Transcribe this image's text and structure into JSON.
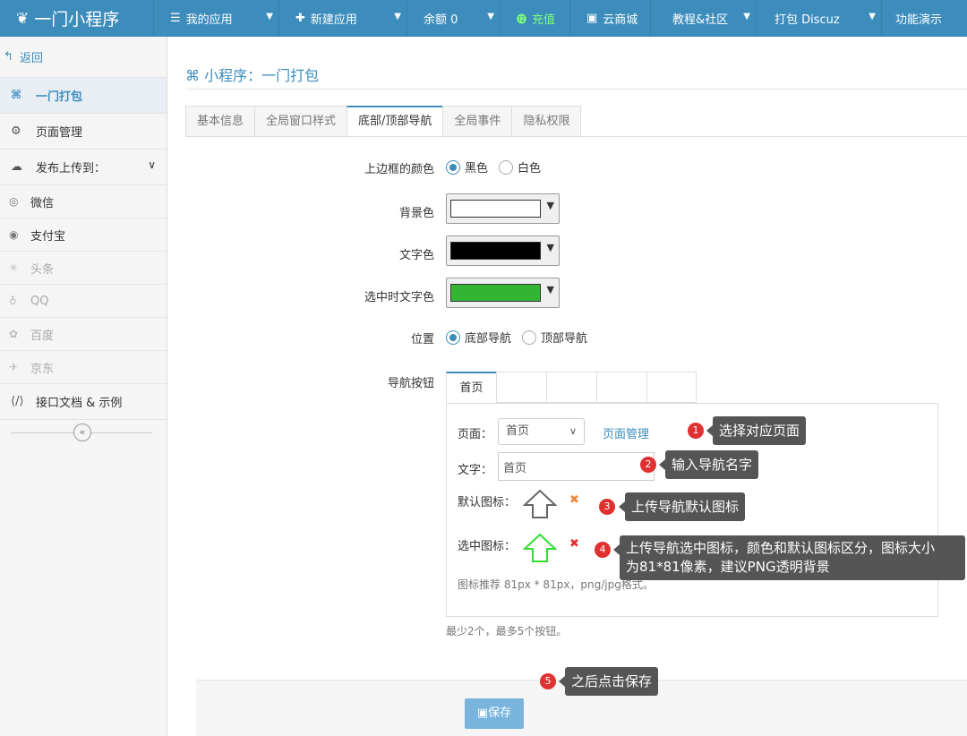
{
  "topbar": {
    "brand": "一门小程序",
    "items": [
      {
        "icon": "list-icon",
        "label": "我的应用",
        "caret": true
      },
      {
        "icon": "plus-icon",
        "label": "新建应用",
        "caret": true
      },
      {
        "icon": "",
        "label": "余额 0",
        "caret": true
      },
      {
        "icon": "yen-icon",
        "label": "充值",
        "caret": false
      },
      {
        "icon": "save-icon",
        "label": "云商城",
        "caret": false
      },
      {
        "icon": "",
        "label": "教程&社区",
        "caret": true
      },
      {
        "icon": "",
        "label": "打包 Discuz",
        "caret": true
      },
      {
        "icon": "",
        "label": "功能演示",
        "caret": false
      }
    ]
  },
  "sidebar": {
    "back": "返回",
    "items": {
      "pack": "一门打包",
      "pages": "页面管理",
      "publish": "发布上传到：",
      "docs": "接口文档 & 示例"
    },
    "platforms": [
      "微信",
      "支付宝",
      "头条",
      "QQ",
      "百度",
      "京东"
    ]
  },
  "main": {
    "title": "小程序：一门打包",
    "tabs": [
      "基本信息",
      "全局窗口样式",
      "底部/顶部导航",
      "全局事件",
      "隐私权限"
    ],
    "form": {
      "border_color_label": "上边框的颜色",
      "border_black": "黑色",
      "border_white": "白色",
      "bg_label": "背景色",
      "bg_value": "#ffffff",
      "text_label": "文字色",
      "text_value": "#000000",
      "selected_label": "选中时文字色",
      "selected_value": "#33b533",
      "position_label": "位置",
      "pos_bottom": "底部导航",
      "pos_top": "顶部导航",
      "navbtn_label": "导航按钮",
      "navtabs": [
        "首页",
        "",
        "",
        "",
        ""
      ],
      "page_label": "页面：",
      "page_value": "首页",
      "page_manage": "页面管理",
      "text_field_label": "文字：",
      "text_field_value": "首页",
      "default_icon_label": "默认图标：",
      "selected_icon_label": "选中图标：",
      "icon_hint": "图标推荐 81px * 81px，png/jpg格式。",
      "btn_hint": "最少2个，最多5个按钮。"
    },
    "save": "保存"
  },
  "tips": [
    {
      "num": "1",
      "text": "选择对应页面"
    },
    {
      "num": "2",
      "text": "输入导航名字"
    },
    {
      "num": "3",
      "text": "上传导航默认图标"
    },
    {
      "num": "4",
      "text1": "上传导航选中图标，颜色和默认图标区分，图标大小",
      "text2": "为81*81像素，建议PNG透明背景"
    },
    {
      "num": "5",
      "text": "之后点击保存"
    }
  ]
}
